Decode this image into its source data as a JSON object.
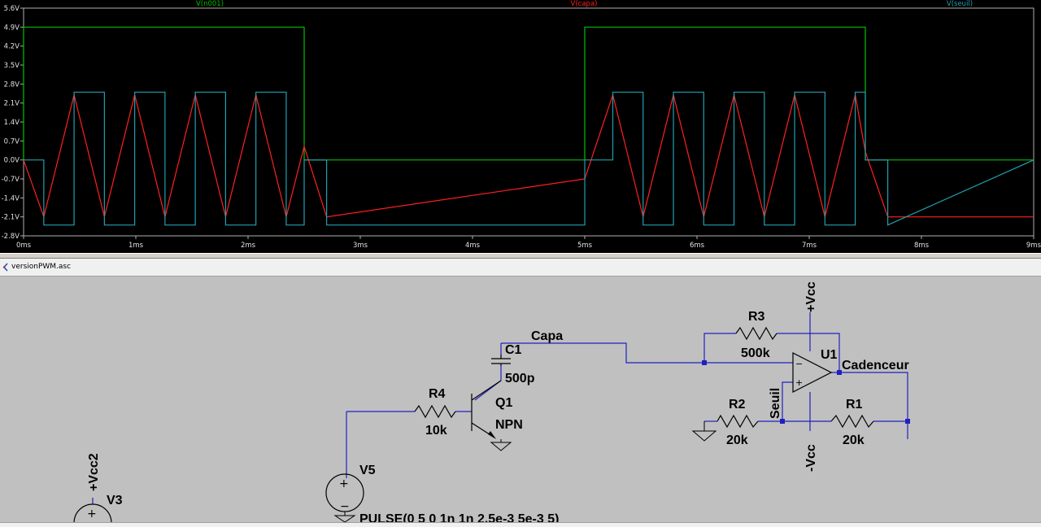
{
  "plot": {
    "traces": [
      {
        "name": "V(n001)",
        "color": "#00c000"
      },
      {
        "name": "V(capa)",
        "color": "#ff2020"
      },
      {
        "name": "V(seuil)",
        "color": "#20a0b0"
      }
    ],
    "y_ticks": [
      "5.6V",
      "4.9V",
      "4.2V",
      "3.5V",
      "2.8V",
      "2.1V",
      "1.4V",
      "0.7V",
      "0.0V",
      "-0.7V",
      "-1.4V",
      "-2.1V",
      "-2.8V"
    ],
    "x_ticks": [
      "0ms",
      "1ms",
      "2ms",
      "3ms",
      "4ms",
      "5ms",
      "6ms",
      "7ms",
      "8ms",
      "9ms"
    ],
    "background": "#000000"
  },
  "chart_data": {
    "type": "line",
    "xlabel": "",
    "ylabel": "",
    "xunit": "ms",
    "yunit": "V",
    "xlim": [
      0,
      9
    ],
    "ylim": [
      -2.8,
      5.6
    ],
    "grid": false,
    "series": [
      {
        "name": "V(n001)",
        "x": [
          0,
          0,
          2.5,
          2.5,
          5,
          5,
          7.5,
          7.5,
          9
        ],
        "values": [
          0,
          4.9,
          4.9,
          0,
          0,
          4.9,
          4.9,
          0,
          0
        ]
      },
      {
        "name": "V(capa)",
        "x": [
          0,
          0.18,
          0.45,
          0.72,
          0.99,
          1.26,
          1.53,
          1.8,
          2.07,
          2.34,
          2.5,
          2.7,
          5,
          5.25,
          5.52,
          5.79,
          6.06,
          6.33,
          6.6,
          6.87,
          7.14,
          7.41,
          7.5,
          7.7
        ],
        "values": [
          0,
          -2.1,
          2.4,
          -2.1,
          2.4,
          -2.1,
          2.4,
          -2.1,
          2.4,
          -2.1,
          0.5,
          -2.1,
          -0.7,
          2.4,
          -2.1,
          2.4,
          -2.1,
          2.4,
          -2.1,
          2.4,
          -2.1,
          2.4,
          0.3,
          -2.1
        ]
      },
      {
        "name": "V(seuil)",
        "x": [
          0,
          0.18,
          0.45,
          0.72,
          0.99,
          1.26,
          1.53,
          1.8,
          2.07,
          2.34,
          2.5,
          2.7,
          5,
          5.25,
          5.52,
          5.79,
          6.06,
          6.33,
          6.6,
          6.87,
          7.14,
          7.41,
          7.5,
          7.7
        ],
        "values": [
          0,
          -2.4,
          2.5,
          -2.4,
          2.5,
          -2.4,
          2.5,
          -2.4,
          2.5,
          -2.4,
          0,
          -2.4,
          0,
          2.5,
          -2.4,
          2.5,
          -2.4,
          2.5,
          -2.4,
          2.5,
          -2.4,
          2.5,
          0,
          -2.4
        ]
      }
    ]
  },
  "document_tab": {
    "title": "versionPWM.asc"
  },
  "schematic": {
    "net_labels": {
      "capa": "Capa",
      "cadenceur": "Cadenceur",
      "seuil": "Seuil",
      "vcc_pos": "+Vcc",
      "vcc_neg": "-Vcc",
      "vcc2": "+Vcc2"
    },
    "components": {
      "r3": {
        "name": "R3",
        "value": "500k"
      },
      "r2": {
        "name": "R2",
        "value": "20k"
      },
      "r1": {
        "name": "R1",
        "value": "20k"
      },
      "r4": {
        "name": "R4",
        "value": "10k"
      },
      "c1": {
        "name": "C1",
        "value": "500p"
      },
      "q1": {
        "name": "Q1",
        "value": "NPN"
      },
      "u1": {
        "name": "U1"
      },
      "v5": {
        "name": "V5",
        "value": "PULSE(0 5 0 1n 1n 2.5e-3 5e-3 5)"
      },
      "v3": {
        "name": "V3"
      }
    },
    "wire_color": "#2020c0"
  }
}
